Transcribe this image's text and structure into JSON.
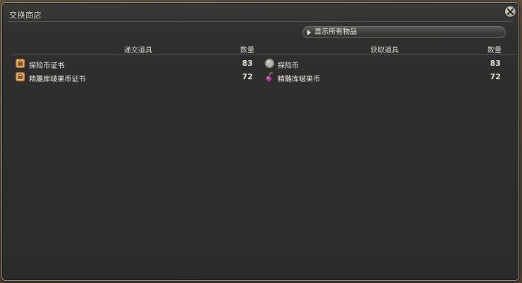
{
  "window": {
    "title": "交换商店",
    "close_icon": "close-x-icon"
  },
  "filter": {
    "show_all_label": "显示所有物品"
  },
  "table": {
    "headers": {
      "give_item": "递交道具",
      "give_qty": "数量",
      "receive_item": "获取道具",
      "receive_qty": "数量"
    },
    "rows": [
      {
        "give_icon": "certificate-box-icon",
        "give_name": "探险币证书",
        "give_qty": "83",
        "receive_icon": "explorer-coin-icon",
        "receive_name": "探险币",
        "receive_qty": "83"
      },
      {
        "give_icon": "certificate-box-icon",
        "give_name": "精雕库啵果币证书",
        "give_qty": "72",
        "receive_icon": "kupo-nut-coin-icon",
        "receive_name": "精雕库啵果币",
        "receive_qty": "72"
      }
    ]
  },
  "colors": {
    "panel_bg": "#2b2b2b",
    "border": "#8a8a84",
    "text": "#e9e6dc"
  }
}
